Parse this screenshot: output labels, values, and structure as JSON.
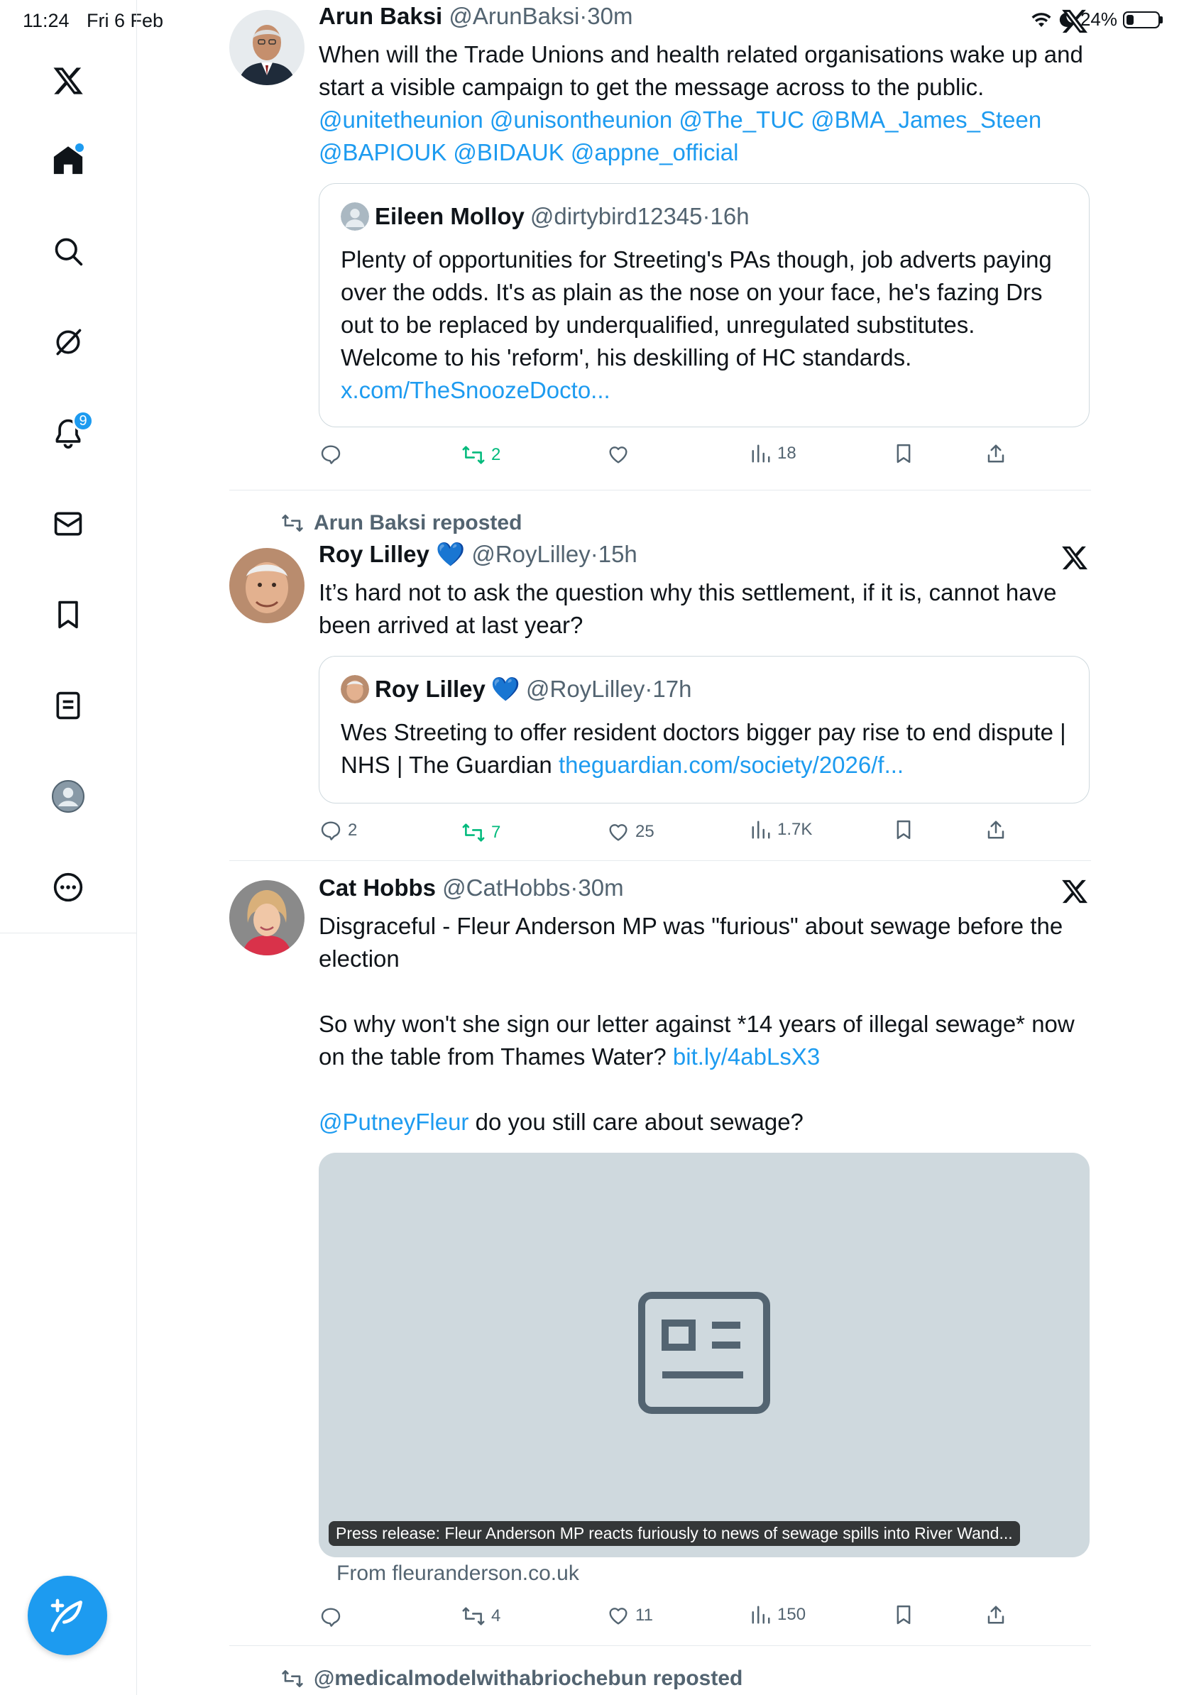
{
  "status_bar": {
    "time": "11:24",
    "date": "Fri 6 Feb",
    "battery": "24%",
    "battery_level": 0.24
  },
  "sidebar": {
    "items": [
      {
        "name": "x-logo"
      },
      {
        "name": "home"
      },
      {
        "name": "search"
      },
      {
        "name": "grok"
      },
      {
        "name": "notifications",
        "badge": "9"
      },
      {
        "name": "messages"
      },
      {
        "name": "bookmarks"
      },
      {
        "name": "lists"
      },
      {
        "name": "profile"
      },
      {
        "name": "more"
      }
    ],
    "compose": "compose"
  },
  "colors": {
    "accent": "#1d9bf0",
    "repost_green": "#00ba7c",
    "muted": "#536471",
    "border": "#cfd9de"
  },
  "tweets": [
    {
      "author": "Arun Baksi",
      "handle": "@ArunBaksi",
      "time": "30m",
      "text": "When will the Trade Unions and health related organisations wake up and start a visible campaign to get the message across to the public.",
      "mentions": "@unitetheunion @unisontheunion @The_TUC @BMA_James_Steen @BAPIOUK @BIDAUK @appne_official",
      "quote": {
        "author": "Eileen Molloy",
        "handle": "@dirtybird12345",
        "time": "16h",
        "text": "Plenty of opportunities for Streeting's PAs though, job adverts paying over the odds.  It's as plain as the nose on your face, he's fazing Drs out to be replaced by underqualified, unregulated substitutes. Welcome to his 'reform', his deskilling of HC standards.",
        "link": "x.com/TheSnoozeDocto..."
      },
      "stats": {
        "replies": "",
        "reposts": "2",
        "likes": "",
        "views": "18"
      }
    },
    {
      "reposted_by": "Arun Baksi reposted",
      "author": "Roy Lilley",
      "verified_emoji": "💙",
      "handle": "@RoyLilley",
      "time": "15h",
      "text": "It’s hard not to ask the question why this settlement, if it is, cannot have been arrived at last year?",
      "quote": {
        "author": "Roy Lilley",
        "verified_emoji": "💙",
        "handle": "@RoyLilley",
        "time": "17h",
        "text": "Wes Streeting to offer resident doctors bigger pay rise to end dispute | NHS | The Guardian",
        "link": "theguardian.com/society/2026/f..."
      },
      "stats": {
        "replies": "2",
        "reposts": "7",
        "likes": "25",
        "views": "1.7K"
      }
    },
    {
      "author": "Cat Hobbs",
      "handle": "@CatHobbs",
      "time": "30m",
      "text_line1": "Disgraceful - Fleur Anderson MP was \"furious\" about sewage before the election",
      "text_line2": "So why won't she sign our letter against *14 years of illegal sewage* now on the table from Thames Water?",
      "text_link": "bit.ly/4abLsX3",
      "mention": "@PutneyFleur",
      "text_line3": "do you still care about sewage?",
      "card": {
        "caption": "Press release: Fleur Anderson MP reacts furiously to news of sewage spills into River Wand...",
        "source": "From fleuranderson.co.uk"
      },
      "stats": {
        "replies": "",
        "reposts": "4",
        "likes": "11",
        "views": "150"
      }
    }
  ],
  "next_repost": "@medicalmodelwithabriochebun reposted",
  "separator": "·"
}
